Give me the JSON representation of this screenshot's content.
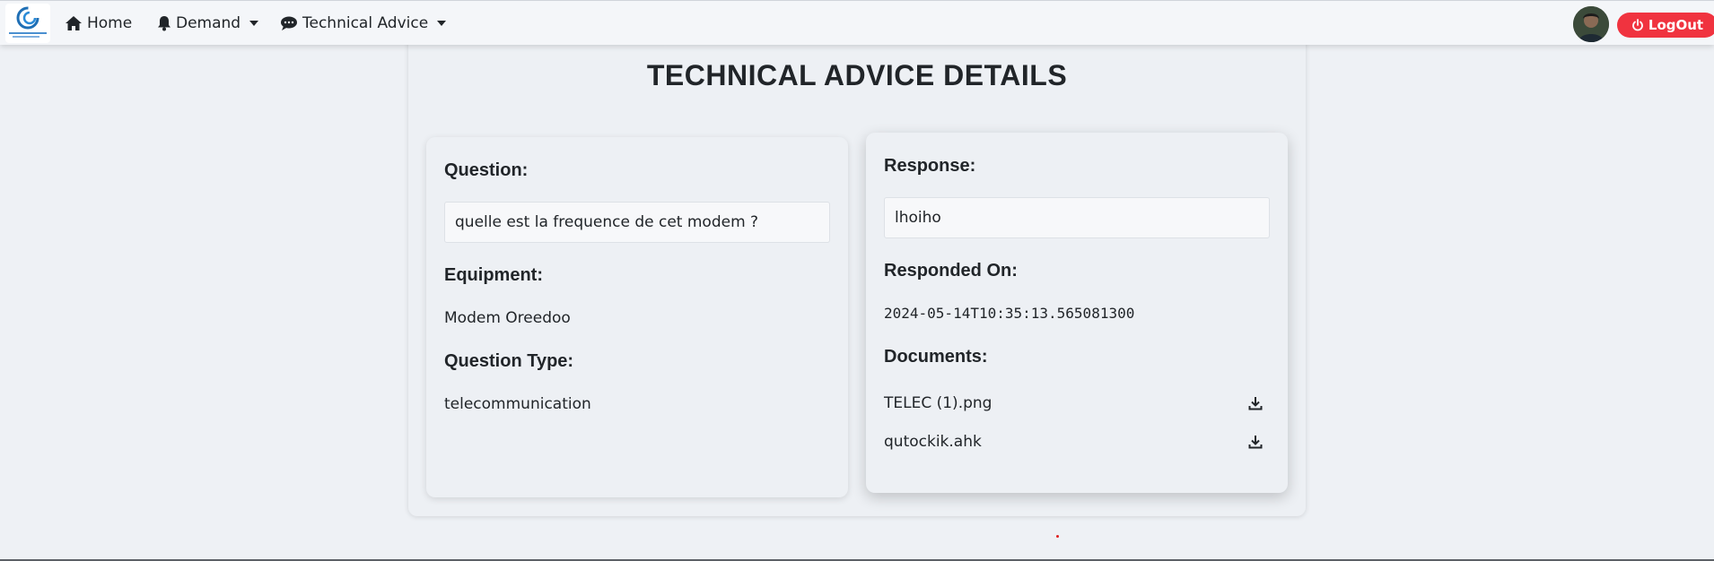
{
  "nav": {
    "items": [
      {
        "label": "Home",
        "icon": "home-icon"
      },
      {
        "label": "Demand",
        "icon": "bell-icon"
      },
      {
        "label": "Technical Advice",
        "icon": "comment-icon"
      }
    ],
    "logout_label": "LogOut"
  },
  "page": {
    "title": "TECHNICAL ADVICE DETAILS"
  },
  "question_card": {
    "question_label": "Question:",
    "question_text": "quelle est la frequence de cet modem ?",
    "equipment_label": "Equipment:",
    "equipment_value": "Modem Oreedoo",
    "type_label": "Question Type:",
    "type_value": "telecommunication"
  },
  "response_card": {
    "response_label": "Response:",
    "response_text": "lhoiho",
    "responded_label": "Responded On:",
    "responded_value": "2024-05-14T10:35:13.565081300",
    "documents_label": "Documents:",
    "documents": [
      {
        "name": "TELEC (1).png",
        "icon": "download-icon"
      },
      {
        "name": "qutockik.ahk",
        "icon": "download-icon"
      }
    ]
  },
  "colors": {
    "background": "#eef1f5",
    "logout_button": "#f0333f",
    "text": "#212529"
  }
}
